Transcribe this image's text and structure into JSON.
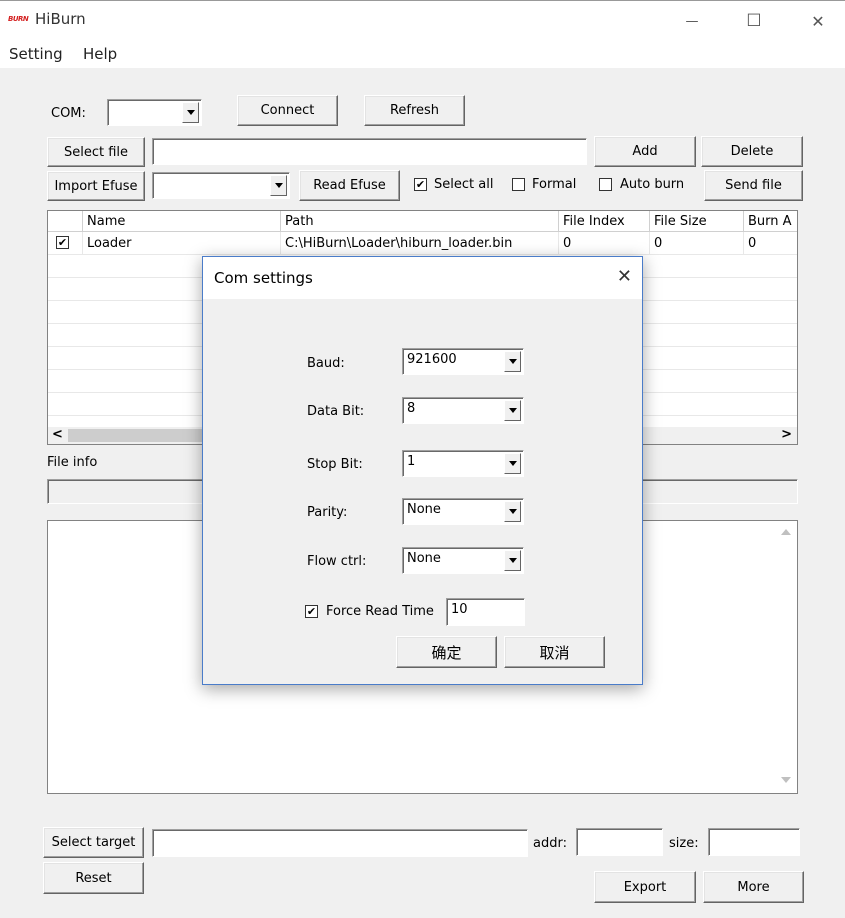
{
  "window": {
    "logo": "BURN",
    "title": "HiBurn",
    "controls": {
      "minimize": "—",
      "maximize": "☐",
      "close": "✕"
    }
  },
  "menu": {
    "setting": "Setting",
    "help": "Help"
  },
  "toolbar": {
    "com_label": "COM:",
    "com_value": "",
    "connect": "Connect",
    "refresh": "Refresh",
    "select_file": "Select file",
    "select_file_value": "",
    "add": "Add",
    "delete": "Delete",
    "import_efuse": "Import Efuse",
    "efuse_value": "",
    "read_efuse": "Read Efuse",
    "select_all": {
      "label": "Select all",
      "checked": true
    },
    "formal": {
      "label": "Formal",
      "checked": false
    },
    "auto_burn": {
      "label": "Auto burn",
      "checked": false
    },
    "send_file": "Send file"
  },
  "file_list": {
    "columns": [
      "Name",
      "Path",
      "File Index",
      "File Size",
      "Burn A"
    ],
    "rows": [
      {
        "checked": true,
        "name": "Loader",
        "path": "C:\\HiBurn\\Loader\\hiburn_loader.bin",
        "index": "0",
        "size": "0",
        "burn": "0"
      }
    ],
    "scroll_left": "<",
    "scroll_right": ">"
  },
  "file_info": {
    "label": "File info",
    "value": ""
  },
  "bottom": {
    "select_target": "Select target",
    "target_value": "",
    "addr_label": "addr:",
    "addr_value": "",
    "size_label": "size:",
    "size_value": "",
    "reset": "Reset",
    "export": "Export",
    "more": "More"
  },
  "dialog": {
    "title": "Com settings",
    "close": "✕",
    "baud_label": "Baud:",
    "baud_value": "921600",
    "data_bit_label": "Data Bit:",
    "data_bit_value": "8",
    "stop_bit_label": "Stop Bit:",
    "stop_bit_value": "1",
    "parity_label": "Parity:",
    "parity_value": "None",
    "flow_label": "Flow ctrl:",
    "flow_value": "None",
    "force_read": {
      "label": "Force Read Time",
      "checked": true,
      "value": "10"
    },
    "ok": "确定",
    "cancel": "取消"
  },
  "colors": {
    "accent_border": "#4a7cc9",
    "logo_red": "#d42020"
  }
}
